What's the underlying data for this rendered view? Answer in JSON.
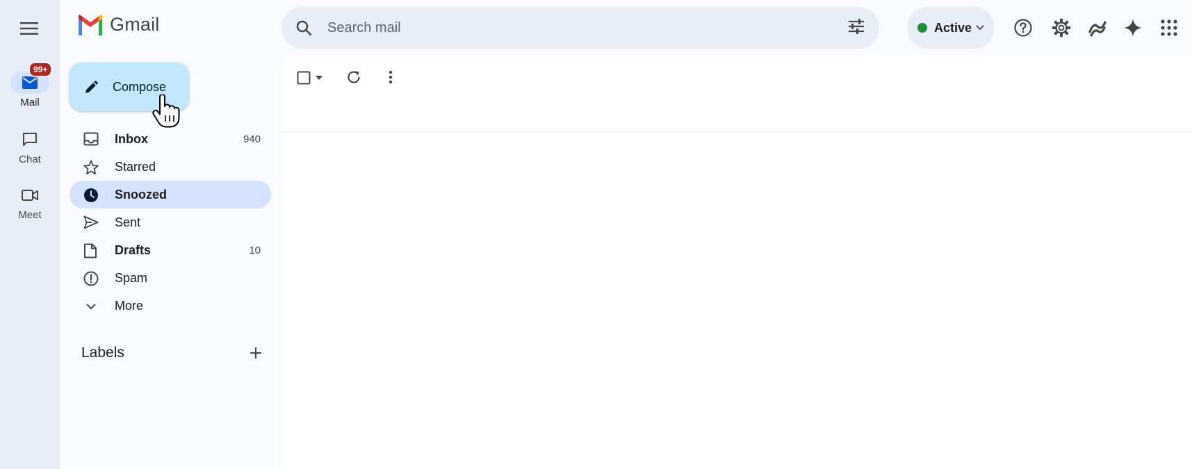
{
  "app": {
    "name": "Gmail"
  },
  "rail": {
    "items": [
      {
        "label": "Mail",
        "badge": "99+",
        "icon": "mail-icon"
      },
      {
        "label": "Chat",
        "icon": "chat-icon"
      },
      {
        "label": "Meet",
        "icon": "meet-icon"
      }
    ]
  },
  "search": {
    "placeholder": "Search mail"
  },
  "status": {
    "label": "Active",
    "color": "#1e8e3e"
  },
  "header_icons": [
    "help-icon",
    "settings-icon",
    "gemini-apps-icon",
    "gemini-icon",
    "apps-grid-icon"
  ],
  "compose": {
    "label": "Compose",
    "color": "#c2e7ff"
  },
  "nav": {
    "items": [
      {
        "label": "Inbox",
        "count": "940",
        "icon": "inbox-icon",
        "bold": true
      },
      {
        "label": "Starred",
        "count": "",
        "icon": "star-icon",
        "bold": false
      },
      {
        "label": "Snoozed",
        "count": "",
        "icon": "clock-icon",
        "bold": true,
        "active": true
      },
      {
        "label": "Sent",
        "count": "",
        "icon": "send-icon",
        "bold": false
      },
      {
        "label": "Drafts",
        "count": "10",
        "icon": "draft-icon",
        "bold": true
      },
      {
        "label": "Spam",
        "count": "",
        "icon": "spam-icon",
        "bold": false
      },
      {
        "label": "More",
        "count": "",
        "icon": "chevron-down-icon",
        "bold": false
      }
    ]
  },
  "labels": {
    "heading": "Labels"
  },
  "colors": {
    "active_nav": "#d3e3fd",
    "background": "#f8fafd",
    "rail": "#e9eef6",
    "badge": "#b3261e"
  }
}
